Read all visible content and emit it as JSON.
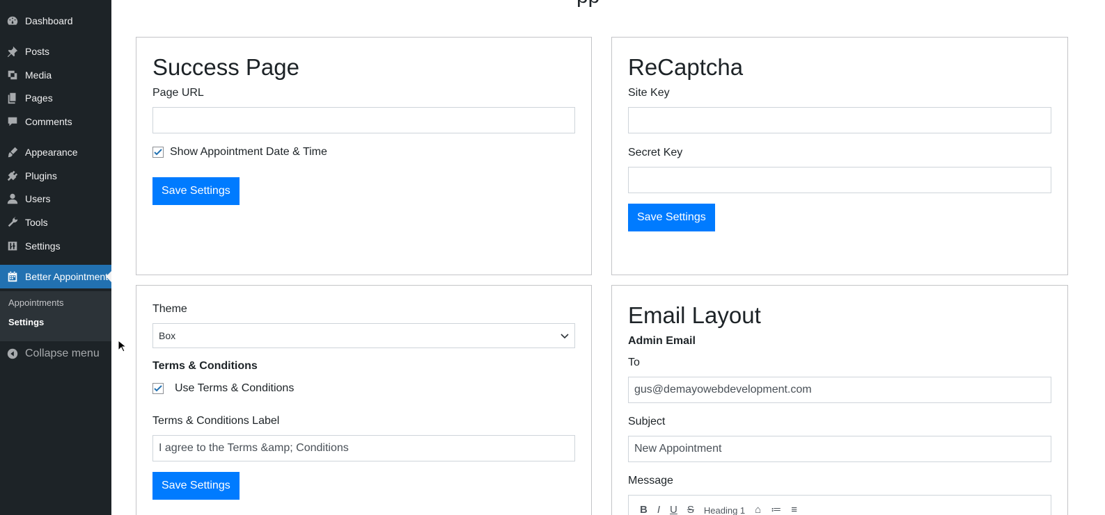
{
  "sidebar": {
    "items": [
      {
        "label": "Dashboard",
        "icon": "dashboard-icon"
      },
      {
        "label": "Posts",
        "icon": "pushpin-icon"
      },
      {
        "label": "Media",
        "icon": "media-icon"
      },
      {
        "label": "Pages",
        "icon": "pages-icon"
      },
      {
        "label": "Comments",
        "icon": "comment-icon"
      },
      {
        "label": "Appearance",
        "icon": "brush-icon"
      },
      {
        "label": "Plugins",
        "icon": "plugin-icon"
      },
      {
        "label": "Users",
        "icon": "user-icon"
      },
      {
        "label": "Tools",
        "icon": "wrench-icon"
      },
      {
        "label": "Settings",
        "icon": "settings-icon"
      },
      {
        "label": "Better Appointments",
        "icon": "calendar-icon"
      }
    ],
    "submenu": [
      {
        "label": "Appointments"
      },
      {
        "label": "Settings"
      }
    ],
    "collapse_label": "Collapse menu"
  },
  "page_heading_fragment": "pp",
  "success_page": {
    "title": "Success Page",
    "page_url_label": "Page URL",
    "page_url_value": "",
    "show_datetime_label": "Show Appointment Date & Time",
    "show_datetime_checked": true,
    "save_label": "Save Settings"
  },
  "recaptcha": {
    "title": "ReCaptcha",
    "site_key_label": "Site Key",
    "site_key_value": "",
    "secret_key_label": "Secret Key",
    "secret_key_value": "",
    "save_label": "Save Settings"
  },
  "theme_panel": {
    "theme_label": "Theme",
    "theme_selected": "Box",
    "terms_heading": "Terms & Conditions",
    "use_terms_label": "Use Terms & Conditions",
    "use_terms_checked": true,
    "terms_label_label": "Terms & Conditions Label",
    "terms_label_value": "I agree to the Terms &amp; Conditions",
    "save_label": "Save Settings"
  },
  "email_layout": {
    "title": "Email Layout",
    "admin_email_heading": "Admin Email",
    "to_label": "To",
    "to_value": "gus@demayowebdevelopment.com",
    "subject_label": "Subject",
    "subject_value": "New Appointment",
    "message_label": "Message",
    "toolbar": [
      "B",
      "I",
      "U",
      "S",
      "Heading 1",
      "⌂",
      "≔",
      "≡"
    ]
  },
  "colors": {
    "sidebar_bg": "#1d2327",
    "active_menu": "#2271b1",
    "button_primary": "#007bff"
  }
}
